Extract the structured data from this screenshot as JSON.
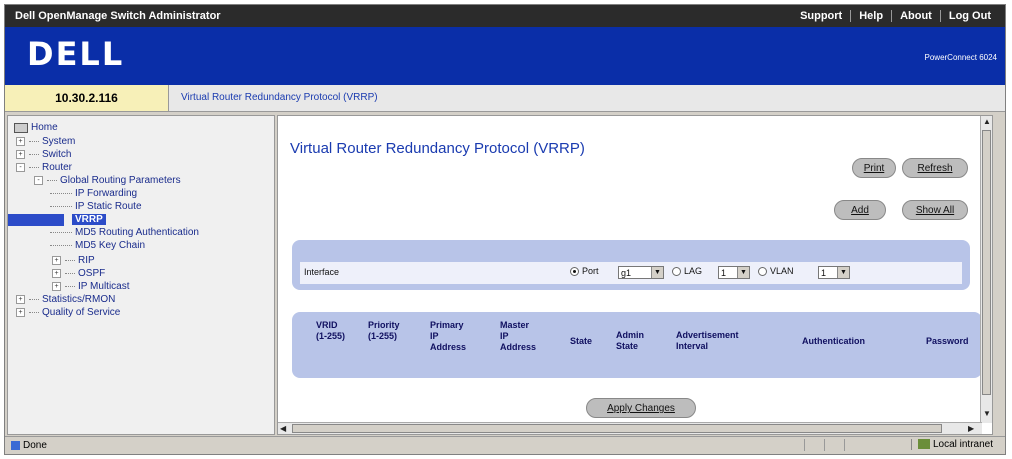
{
  "window": {
    "app_title": "Dell OpenManage Switch Administrator",
    "links": [
      "Support",
      "Help",
      "About",
      "Log Out"
    ]
  },
  "banner": {
    "logo": "DELL",
    "model": "PowerConnect 6024"
  },
  "address": {
    "ip": "10.30.2.116",
    "breadcrumb": "Virtual Router Redundancy Protocol (VRRP)"
  },
  "tree": {
    "home": "Home",
    "system": "System",
    "switch": "Switch",
    "router": "Router",
    "global_routing": "Global Routing Parameters",
    "ip_forwarding": "IP Forwarding",
    "ip_static_route": "IP Static Route",
    "vrrp": "VRRP",
    "md5_routing_auth": "MD5 Routing Authentication",
    "md5_key_chain": "MD5 Key Chain",
    "rip": "RIP",
    "ospf": "OSPF",
    "ip_multicast": "IP Multicast",
    "statistics": "Statistics/RMON",
    "qos": "Quality of Service"
  },
  "page": {
    "title": "Virtual Router Redundancy Protocol (VRRP)",
    "print_button": "Print",
    "refresh_button": "Refresh",
    "add_button": "Add",
    "show_all_button": "Show All",
    "apply_button": "Apply Changes"
  },
  "interface": {
    "label": "Interface",
    "port_label": "Port",
    "port_value": "g1",
    "lag_label": "LAG",
    "lag_value": "1",
    "vlan_label": "VLAN",
    "vlan_value": "1"
  },
  "table": {
    "columns": [
      {
        "line1": "VRID",
        "line2": "(1-255)"
      },
      {
        "line1": "Priority",
        "line2": "(1-255)"
      },
      {
        "line1": "Primary",
        "line2": "IP",
        "line3": "Address"
      },
      {
        "line1": "Master",
        "line2": "IP",
        "line3": "Address"
      },
      {
        "line1": "State"
      },
      {
        "line1": "Admin",
        "line2": "State"
      },
      {
        "line1": "Advertisement",
        "line2": "Interval"
      },
      {
        "line1": "Authentication"
      },
      {
        "line1": "Password"
      }
    ]
  },
  "status": {
    "done": "Done",
    "zone": "Local intranet"
  }
}
